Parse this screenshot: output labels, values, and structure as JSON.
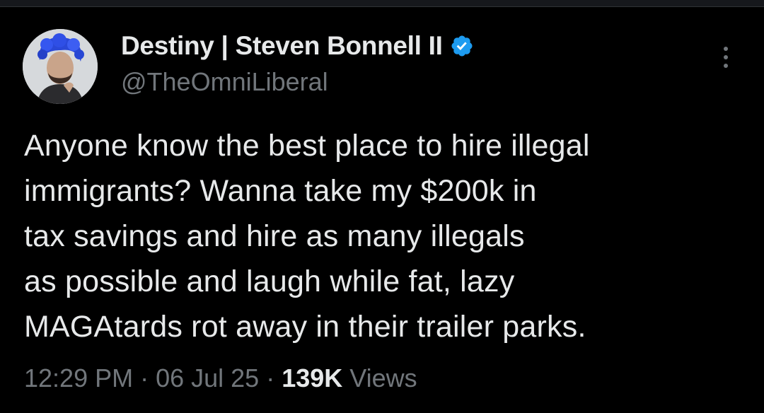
{
  "tweet": {
    "display_name": "Destiny | Steven Bonnell II",
    "handle": "@TheOmniLiberal",
    "text": "Anyone know the best place to hire illegal\nimmigrants? Wanna take my $200k in\ntax savings and hire as many illegals\nas possible and laugh while fat, lazy\nMAGAtards rot away in their trailer parks.",
    "time": "12:29 PM",
    "sep1": " · ",
    "date": "06 Jul 25",
    "sep2": " · ",
    "views_count": "139K",
    "views_label": " Views"
  },
  "colors": {
    "background": "#000000",
    "text": "#e7e9ea",
    "muted": "#71767b",
    "verified": "#1d9bf0"
  },
  "icons": {
    "verified": "verified-badge-icon",
    "more": "more-options-icon"
  }
}
